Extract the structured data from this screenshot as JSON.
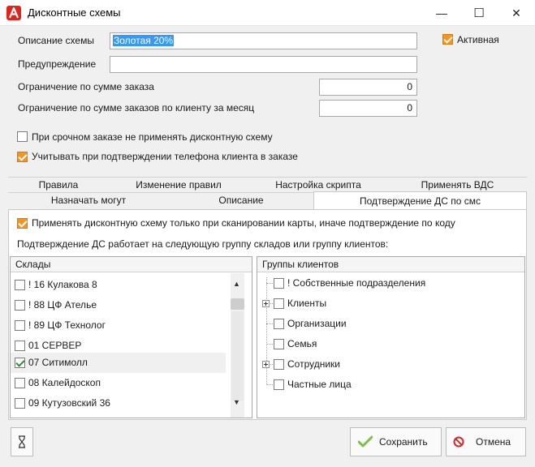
{
  "window": {
    "title": "Дисконтные схемы",
    "app_icon_letter": "А",
    "minimize": "—",
    "maximize": "☐",
    "close": "✕"
  },
  "form": {
    "description_label": "Описание схемы",
    "description_value": "Золотая 20%",
    "warning_label": "Предупреждение",
    "warning_value": "",
    "order_limit_label": "Ограничение по сумме заказа",
    "order_limit_value": "0",
    "monthly_limit_label": "Ограничение по сумме заказов по клиенту за месяц",
    "monthly_limit_value": "0",
    "active_label": "Активная",
    "active_checked": true,
    "urgent_label": "При срочном заказе не применять дисконтную схему",
    "urgent_checked": false,
    "phone_label": "Учитывать при подтверждении телефона клиента в заказе",
    "phone_checked": true
  },
  "tabs": {
    "row1": [
      "Правила",
      "Изменение правил",
      "Настройка скрипта",
      "Применять ВДС"
    ],
    "row2": [
      "Назначать могут",
      "Описание",
      "Подтверждение ДС по смс"
    ],
    "active": "Подтверждение ДС по смс"
  },
  "panel": {
    "scan_label": "Применять дисконтную схему только при сканировании карты, иначе подтверждение по коду",
    "scan_checked": true,
    "group_text": "Подтверждение ДС работает на следующую группу складов или группу клиентов:"
  },
  "warehouses": {
    "header": "Склады",
    "items": [
      {
        "label": "! 16 Кулакова 8",
        "checked": false
      },
      {
        "label": "! 88 ЦФ Ателье",
        "checked": false
      },
      {
        "label": "! 89 ЦФ Технолог",
        "checked": false
      },
      {
        "label": "01 СЕРВЕР",
        "checked": false
      },
      {
        "label": "07 Ситимолл",
        "checked": true
      },
      {
        "label": "08 Калейдоскоп",
        "checked": false
      },
      {
        "label": "09 Кутузовский 36",
        "checked": false
      }
    ],
    "scroll_up": "▲",
    "scroll_down": "▼"
  },
  "client_groups": {
    "header": "Группы клиентов",
    "items": [
      {
        "label": "! Собственные подразделения",
        "expandable": false
      },
      {
        "label": "Клиенты",
        "expandable": true
      },
      {
        "label": "Организации",
        "expandable": false
      },
      {
        "label": "Семья",
        "expandable": false
      },
      {
        "label": "Сотрудники",
        "expandable": true
      },
      {
        "label": "Частные лица",
        "expandable": false
      }
    ]
  },
  "buttons": {
    "save": "Сохранить",
    "cancel": "Отмена"
  },
  "colors": {
    "accent_orange": "#f7941d",
    "selection_blue": "#3399ff",
    "save_green": "#7cc242",
    "cancel_red": "#d9262a",
    "logo_red": "#e2231a"
  }
}
